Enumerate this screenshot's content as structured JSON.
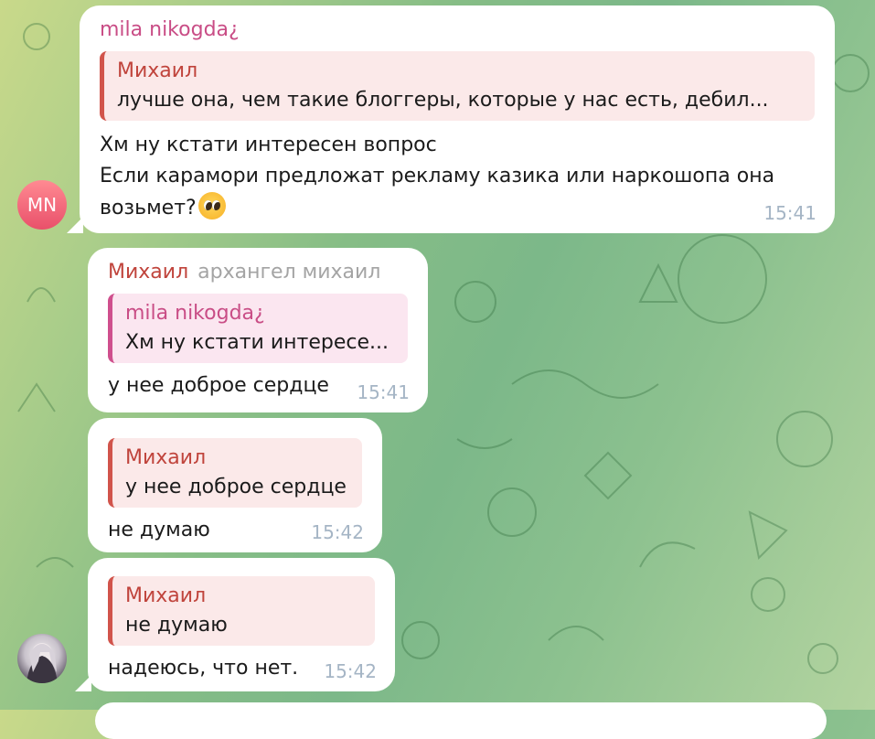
{
  "avatars": {
    "first": {
      "initials": "MN",
      "color": "#ee5b74"
    }
  },
  "messages": [
    {
      "sender": "mila nikogda¿",
      "reply": {
        "name": "Михаил",
        "text": "лучше она, чем такие блоггеры, которые у нас есть, дебил..."
      },
      "lines": [
        "Хм ну кстати интересен вопрос",
        "Если карамори предложат рекламу казика или наркошопа она",
        "возьмет?"
      ],
      "emoji": "pleading-face",
      "time": "15:41"
    },
    {
      "sender": "Михаил",
      "rank": "архангел михаил",
      "reply": {
        "name": "mila nikogda¿",
        "text": "Хм ну кстати интересе..."
      },
      "text": "у нее доброе сердце",
      "time": "15:41"
    },
    {
      "reply": {
        "name": "Михаил",
        "text": "у нее доброе сердце"
      },
      "text": "не думаю",
      "time": "15:42"
    },
    {
      "reply": {
        "name": "Михаил",
        "text": "не думаю"
      },
      "text": "надеюсь, что нет.",
      "time": "15:42"
    }
  ],
  "colors": {
    "accent_pink": "#c94d86",
    "accent_red": "#c0443c",
    "bubble": "#ffffff",
    "time": "#a5b5c5"
  }
}
